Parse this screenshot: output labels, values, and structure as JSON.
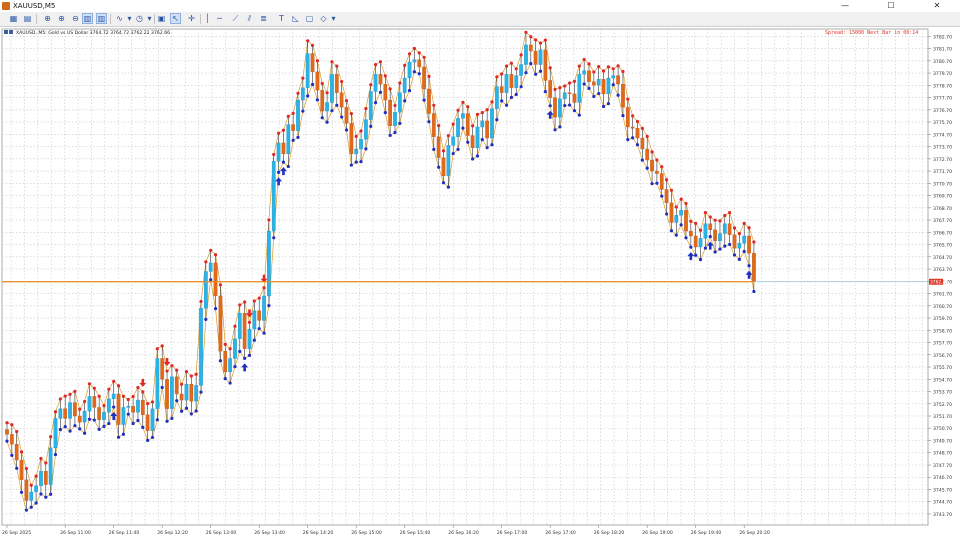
{
  "window": {
    "title": "XAUUSD,M5",
    "min": "—",
    "max": "☐",
    "close": "✕"
  },
  "toolbar": {
    "icons": [
      "new-chart-icon",
      "zoom-in-icon",
      "zoom-out-icon",
      "tile-icon",
      "grid-icon",
      "indicators-icon",
      "timeframe-icon",
      "template-icon",
      "cursor-icon",
      "vertical-line-icon",
      "crosshair-icon",
      "trendline-icon",
      "channel-icon",
      "text-icon",
      "label-icon",
      "rectangle-icon",
      "shapes-icon"
    ]
  },
  "chart_header": {
    "symbol_line": "XAUUSD, M5:  Gold vs US Dollar  3764.72 3764.72 3762.22 3762.66"
  },
  "chart_status": "Spread: 15000 Next Bar in 00:14",
  "current_price": "3762.66",
  "chart_data": {
    "type": "candlestick",
    "ylim": [
      3742.8,
      3783.3
    ],
    "y_ticks": [
      "3782.70",
      "3781.70",
      "3780.70",
      "3779.70",
      "3778.70",
      "3777.70",
      "3776.70",
      "3775.70",
      "3774.70",
      "3773.70",
      "3772.70",
      "3771.70",
      "3770.70",
      "3769.70",
      "3768.70",
      "3767.70",
      "3766.70",
      "3765.70",
      "3764.70",
      "3763.70",
      "3762.70",
      "3761.70",
      "3760.70",
      "3759.70",
      "3758.70",
      "3757.70",
      "3756.70",
      "3755.70",
      "3754.70",
      "3753.70",
      "3752.70",
      "3751.70",
      "3750.70",
      "3749.70",
      "3748.70",
      "3747.70",
      "3746.70",
      "3745.70",
      "3744.70",
      "3743.70"
    ],
    "x_ticks": [
      {
        "i": 0,
        "label": "26 Sep 2025"
      },
      {
        "i": 12,
        "label": "26 Sep 11:00"
      },
      {
        "i": 22,
        "label": "26 Sep 11:40"
      },
      {
        "i": 32,
        "label": "26 Sep 12:20"
      },
      {
        "i": 42,
        "label": "26 Sep 13:00"
      },
      {
        "i": 52,
        "label": "26 Sep 13:40"
      },
      {
        "i": 62,
        "label": "26 Sep 14:20"
      },
      {
        "i": 72,
        "label": "26 Sep 15:00"
      },
      {
        "i": 82,
        "label": "26 Sep 15:40"
      },
      {
        "i": 92,
        "label": "26 Sep 16:20"
      },
      {
        "i": 102,
        "label": "26 Sep 17:00"
      },
      {
        "i": 112,
        "label": "26 Sep 17:40"
      },
      {
        "i": 122,
        "label": "26 Sep 18:20"
      },
      {
        "i": 132,
        "label": "26 Sep 19:00"
      },
      {
        "i": 142,
        "label": "26 Sep 19:40"
      },
      {
        "i": 152,
        "label": "26 Sep 20:20"
      }
    ],
    "closes": [
      3750.2,
      3749.4,
      3748.1,
      3746.5,
      3744.8,
      3745.5,
      3746.0,
      3747.2,
      3746.1,
      3749.1,
      3751.5,
      3752.3,
      3751.5,
      3752.8,
      3751.7,
      3751.2,
      3752.1,
      3753.3,
      3752.4,
      3751.4,
      3752.0,
      3753.1,
      3753.5,
      3751.0,
      3752.4,
      3752.5,
      3752.0,
      3753.0,
      3751.8,
      3750.5,
      3752.3,
      3756.4,
      3754.7,
      3752.3,
      3754.9,
      3753.5,
      3753.0,
      3754.3,
      3752.9,
      3754.2,
      3760.5,
      3763.5,
      3764.2,
      3761.5,
      3757.0,
      3755.3,
      3756.4,
      3758.0,
      3760.1,
      3757.2,
      3758.8,
      3760.3,
      3759.5,
      3761.5,
      3766.8,
      3772.5,
      3774.0,
      3773.1,
      3775.5,
      3775.0,
      3777.5,
      3778.5,
      3781.3,
      3779.8,
      3778.3,
      3776.6,
      3777.3,
      3779.6,
      3778.1,
      3776.9,
      3775.6,
      3773.1,
      3773.5,
      3774.3,
      3775.9,
      3778.2,
      3779.6,
      3778.8,
      3777.5,
      3775.4,
      3776.5,
      3778.1,
      3779.3,
      3780.6,
      3780.8,
      3780.2,
      3778.4,
      3776.4,
      3774.5,
      3772.8,
      3771.3,
      3773.8,
      3774.5,
      3776.0,
      3776.4,
      3774.6,
      3773.6,
      3775.3,
      3775.8,
      3774.4,
      3776.8,
      3778.6,
      3778.1,
      3779.6,
      3778.5,
      3779.5,
      3780.4,
      3782.0,
      3781.5,
      3780.4,
      3781.6,
      3779.1,
      3777.7,
      3776.1,
      3777.6,
      3778.1,
      3778.0,
      3777.3,
      3779.6,
      3779.9,
      3779.0,
      3778.7,
      3779.2,
      3778.0,
      3779.3,
      3779.5,
      3778.8,
      3776.9,
      3775.3,
      3775.2,
      3774.4,
      3773.5,
      3772.6,
      3771.7,
      3771.5,
      3770.2,
      3769.1,
      3767.5,
      3768.1,
      3768.5,
      3766.8,
      3766.4,
      3765.5,
      3766.2,
      3767.4,
      3766.9,
      3766.0,
      3766.6,
      3767.4,
      3766.5,
      3765.4,
      3765.8,
      3766.4,
      3765.0,
      3762.66
    ],
    "buy_arrows": [
      22,
      49,
      56,
      57,
      112,
      141,
      145,
      153
    ],
    "sell_arrows": [
      28,
      33,
      50,
      53
    ]
  }
}
